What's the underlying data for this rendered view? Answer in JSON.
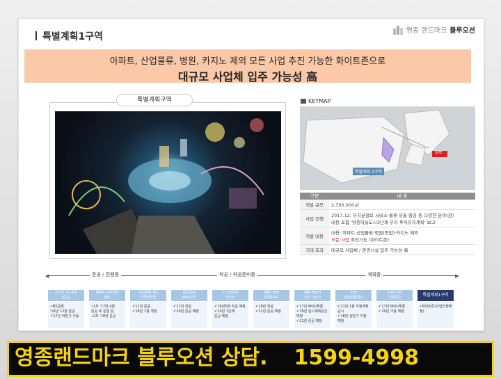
{
  "section_title": "특별계획1구역",
  "brand": {
    "prefix": "영종 랜드마크",
    "name": "블루오션"
  },
  "banner": {
    "line1": "아파트, 산업물류, 병원, 카지노 제외 모든 사업 추진 가능한 화이트존으로",
    "line2": "대규모 사업체 입주 가능성 高"
  },
  "image_label": "특별계획구역",
  "keymap": {
    "heading": "KEYMAP",
    "zone_label": "특별계획 1구역",
    "site_label": "SITE",
    "colors": {
      "zone": "#b9a5e6",
      "site": "#d82020"
    }
  },
  "table": {
    "headers": [
      "구분",
      "내 용"
    ],
    "rows": [
      {
        "key": "개발 규모",
        "lines": [
          "2,300,000㎡"
        ]
      },
      {
        "key": "사업 진행",
        "lines": [
          "2017.12. 부지분할로 서비스·물류·유통·항공 등 다양한 분야(관)",
          "내용 포함 '영종하늘도시3단계 부지 투자유치계획' 보고"
        ]
      },
      {
        "key": "개발 내용",
        "lines": [
          "내용: 아파트·산업물류·병원(종합)·카지노 제외"
        ],
        "highlight": "모든 사업",
        "rest": " 추진가능 (화이트존)"
      },
      {
        "key": "기대 효과",
        "lines": [
          "대규모 사업체 / 관광시설 입주 가능성 高"
        ]
      }
    ]
  },
  "phases": [
    "준공 / 진행중",
    "착공 / 착공준비중",
    "계획중"
  ],
  "steps": [
    {
      "title": [
        "스카이 72 골프",
        "(준공)"
      ],
      "items": [
        "•제2공장",
        " '18년 12월 준공",
        "•'17년 하반기 가동"
      ]
    },
    {
      "title": [
        "BMW 드라이빙",
        "센터"
      ],
      "items": [
        "•1차 '17년 4월",
        " 준공 후 운영 중",
        "•2차 '18년 준공"
      ]
    },
    {
      "title": [
        "인천공항 제2",
        "여객터미널"
      ],
      "items": [
        "•'17년 준공",
        "•'18년 1월 개항"
      ]
    },
    {
      "title": [
        "인천공항",
        "MRO단지"
      ],
      "items": [
        "•'17년 착공",
        "•'20년 준공 예정"
      ]
    },
    {
      "title": [
        "인스파이어",
        "리조트"
      ],
      "items": [
        "•'18년5월 착공 예정",
        "•'20년 1단계",
        " 준공 예정"
      ]
    },
    {
      "title": [
        "영종~청라",
        "제3연륙교"
      ],
      "items": [
        "•'18년 착공",
        "•'21년 준공 예정"
      ]
    },
    {
      "title": [
        "영종 복합리",
        "조트 (씨티)"
      ],
      "items": [
        "•'17년 MOU체결",
        "•'18년 실시계획승인",
        " 예정",
        "•'22년 준공 예정"
      ]
    },
    {
      "title": [
        "인천",
        "글로벌캠퍼스"
      ],
      "items": [
        "•'17년 1월 지정계획",
        " 공시",
        "•'18년 상반기 지정",
        " 예정"
      ]
    },
    {
      "title": [
        "스마트시티",
        "(계획중)"
      ],
      "items": [
        "•'17년 MOU체결",
        "•'20년 가동 예정"
      ]
    },
    {
      "title": [
        "특별계획1구역"
      ],
      "items": [
        "•화이트존(사업진행예정)"
      ],
      "dark": true
    }
  ],
  "footer": {
    "name": "영종랜드마크 블루오션 상담.",
    "phone": "1599-4998"
  }
}
